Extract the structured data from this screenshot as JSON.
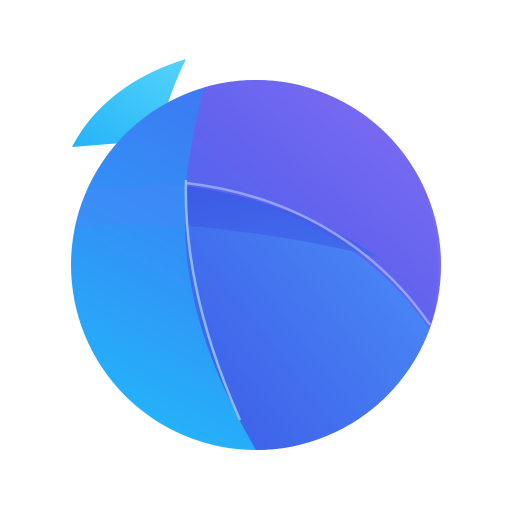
{
  "app_icon": {
    "icon": "split-sphere-logo",
    "colors": {
      "background": "#ffffff",
      "cyan": "#2fc6f6",
      "blue": "#3d8cf5",
      "royal_blue": "#4458e6",
      "violet": "#7b6cf2"
    }
  }
}
